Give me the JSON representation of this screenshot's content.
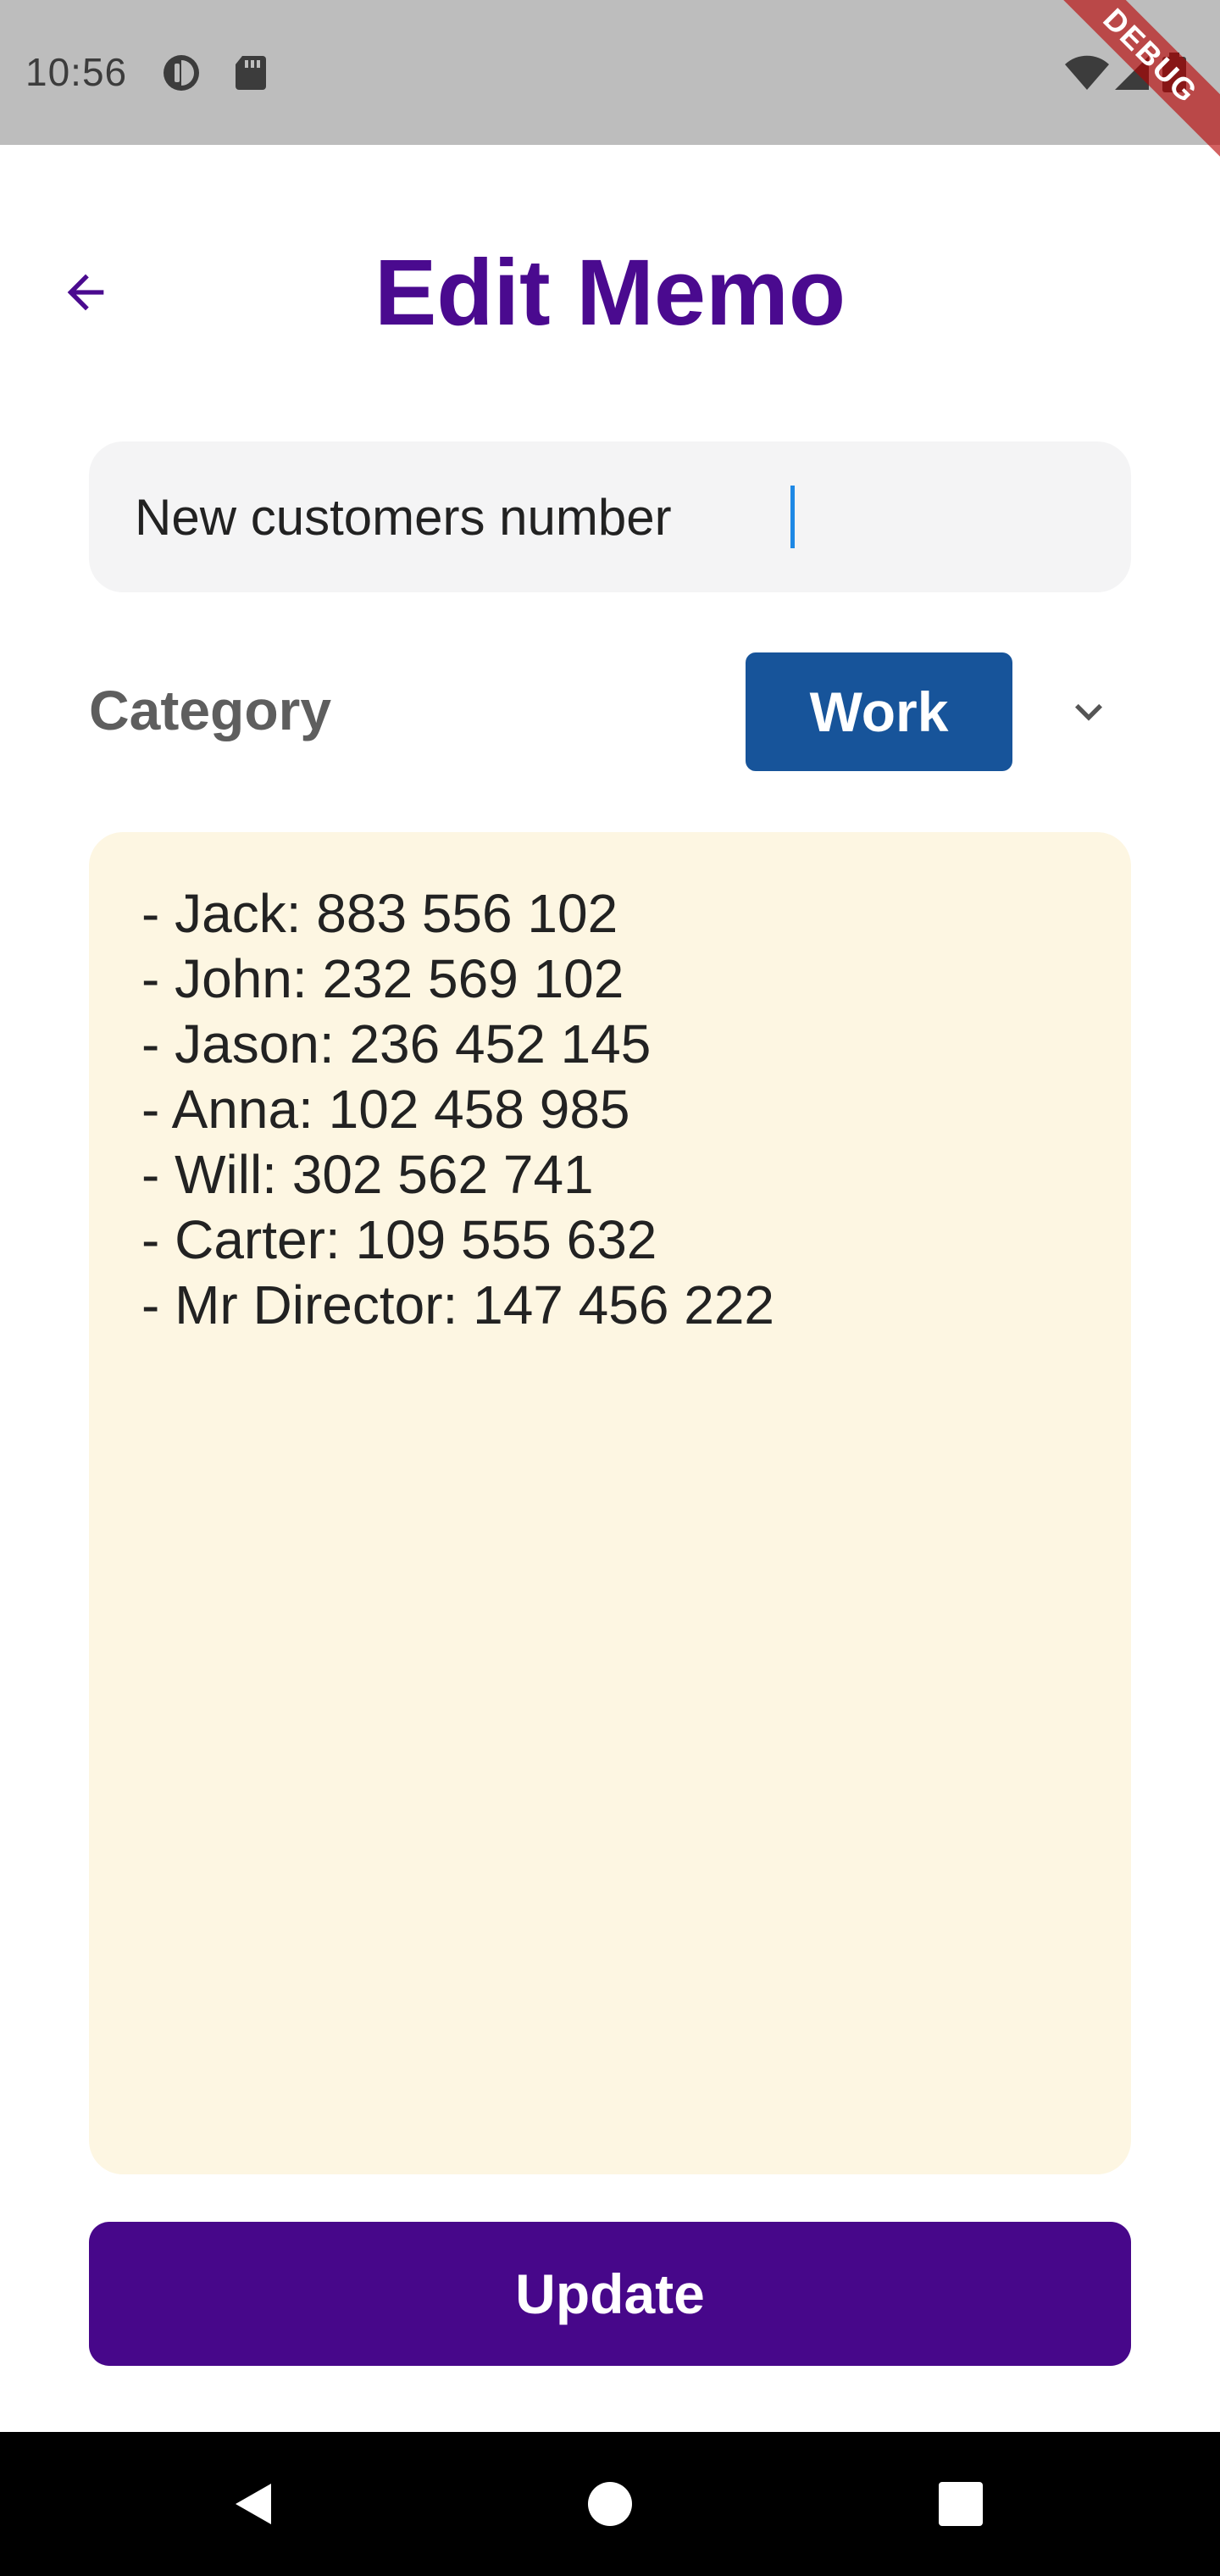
{
  "status_bar": {
    "time": "10:56",
    "debug_label": "DEBUG",
    "color": "#bdbdbd"
  },
  "header": {
    "title": "Edit Memo",
    "back_icon": "arrow-left-icon",
    "accent": "#4a0a8f"
  },
  "title_field": {
    "value": "New customers number",
    "placeholder": ""
  },
  "category": {
    "label": "Category",
    "selected": "Work",
    "chip_color": "#17549a",
    "dropdown_icon": "chevron-down-icon"
  },
  "content": {
    "body": "- Jack: 883 556 102\n- John: 232 569 102\n- Jason: 236 452 145\n- Anna: 102 458 985\n- Will: 302 562 741\n- Carter: 109 555 632\n- Mr Director: 147 456 222",
    "background": "#fdf6e2"
  },
  "actions": {
    "update_label": "Update",
    "update_color": "#47078a"
  },
  "nav_bar": {
    "back_icon": "triangle-back-icon",
    "home_icon": "circle-home-icon",
    "recents_icon": "square-recents-icon"
  }
}
